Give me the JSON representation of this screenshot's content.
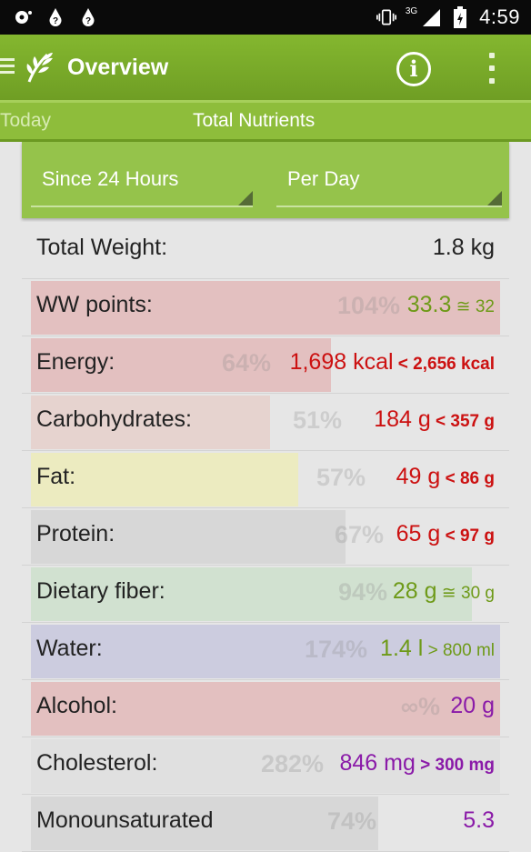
{
  "status_bar": {
    "network_label": "3G",
    "time": "4:59",
    "icons": [
      "notification-icon",
      "drop-question-icon",
      "drop-question-icon",
      "vibrate-icon",
      "signal-icon",
      "battery-icon"
    ]
  },
  "action_bar": {
    "title": "Overview",
    "info_label": "i",
    "colors": {
      "bar": "#7cb12e",
      "text": "#ffffff"
    }
  },
  "tabs": {
    "today": "Today",
    "total_nutrients": "Total Nutrients"
  },
  "filters": {
    "period": "Since 24 Hours",
    "unit": "Per Day"
  },
  "total_weight": {
    "label": "Total Weight:",
    "value": "1.8 kg"
  },
  "nutrients": [
    {
      "name": "WW points:",
      "percent": "104%",
      "percent_value": 104,
      "amount": "33.3",
      "target": " ≅ 32",
      "target_light": true,
      "color": "#6e9a18",
      "bar_color": "#e3c0c0"
    },
    {
      "name": "Energy:",
      "percent": "64%",
      "percent_value": 64,
      "amount": "1,698 kcal",
      "target": " < 2,656 kcal",
      "target_light": false,
      "color": "#cc1111",
      "bar_color": "#e3c0c0"
    },
    {
      "name": "Carbohydrates:",
      "percent": "51%",
      "percent_value": 51,
      "amount": "184 g",
      "target": " < 357 g",
      "target_light": false,
      "color": "#cc1111",
      "bar_color": "#e6d3cf"
    },
    {
      "name": "Fat:",
      "percent": "57%",
      "percent_value": 57,
      "amount": "49 g",
      "target": " < 86 g",
      "target_light": false,
      "color": "#cc1111",
      "bar_color": "#ecebc0"
    },
    {
      "name": "Protein:",
      "percent": "67%",
      "percent_value": 67,
      "amount": "65 g",
      "target": " < 97 g",
      "target_light": false,
      "color": "#cc1111",
      "bar_color": "#d7d7d7"
    },
    {
      "name": "Dietary fiber:",
      "percent": "94%",
      "percent_value": 94,
      "amount": "28 g",
      "target": " ≅ 30 g",
      "target_light": true,
      "color": "#6e9a18",
      "bar_color": "#d1e1d0"
    },
    {
      "name": "Water:",
      "percent": "174%",
      "percent_value": 174,
      "amount": "1.4 l",
      "target": " > 800 ml",
      "target_light": true,
      "color": "#6e9a18",
      "bar_color": "#ccccdf"
    },
    {
      "name": "Alcohol:",
      "percent": "∞%",
      "percent_value": 1000,
      "amount": "20 g",
      "target": "",
      "target_light": false,
      "color": "#8a1aa8",
      "bar_color": "#e3c0c0"
    },
    {
      "name": "Cholesterol:",
      "percent": "282%",
      "percent_value": 282,
      "amount": "846 mg",
      "target": " > 300 mg",
      "target_light": false,
      "color": "#8a1aa8",
      "bar_color": "#e0e0e0"
    },
    {
      "name": "Monounsaturated",
      "percent": "74%",
      "percent_value": 74,
      "amount": "5.3",
      "target": "",
      "target_light": false,
      "color": "#8a1aa8",
      "bar_color": "#d7d7d7"
    }
  ]
}
